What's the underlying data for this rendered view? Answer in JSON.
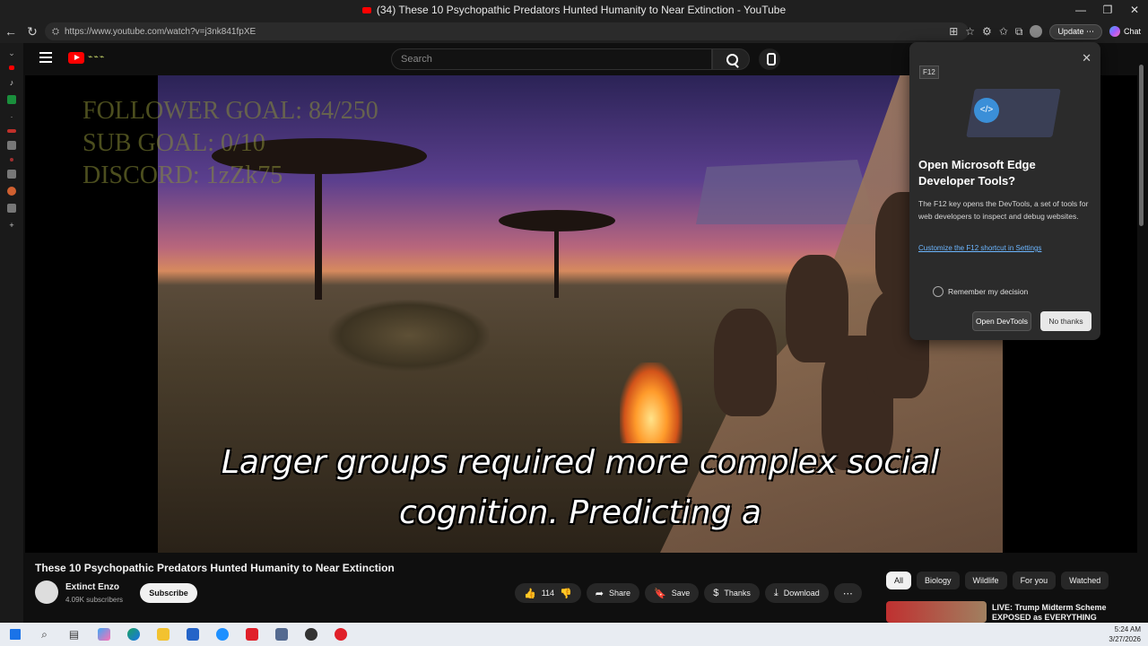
{
  "window": {
    "title": "(34) These 10 Psychopathic Predators Hunted Humanity to Near Extinction - YouTube",
    "controls": [
      "—",
      "❐",
      "✕"
    ]
  },
  "browser": {
    "url": "https://www.youtube.com/watch?v=j3nk841fpXE",
    "update_label": "Update",
    "chat_label": "Chat"
  },
  "header": {
    "search_placeholder": "Search"
  },
  "stream_overlay": {
    "line1": "FOLLOWER GOAL: 84/250",
    "line2": "SUB GOAL: 0/10",
    "line3": "DISCORD: 1zZk75"
  },
  "caption": {
    "line1": "Larger groups required more complex social",
    "line2": "cognition. Predicting a"
  },
  "devtools_popup": {
    "key_badge": "F12",
    "title": "Open Microsoft Edge Developer Tools?",
    "body": "The F12 key opens the DevTools, a set of tools for web developers to inspect and debug websites.",
    "link": "Customize the F12 shortcut in Settings",
    "remember": "Remember my decision",
    "open_btn": "Open DevTools",
    "no_btn": "No thanks"
  },
  "video": {
    "title": "These 10 Psychopathic Predators Hunted Humanity to Near Extinction",
    "channel": "Extinct Enzo",
    "subscribers": "4.09K subscribers",
    "subscribe_label": "Subscribe",
    "likes": "114",
    "share": "Share",
    "save": "Save",
    "thanks": "Thanks",
    "download": "Download"
  },
  "chips": [
    "All",
    "Biology",
    "Wildlife",
    "For you",
    "Watched"
  ],
  "recommendation": {
    "title": "LIVE: Trump Midterm Scheme EXPOSED as EVERYTHING"
  },
  "clock": {
    "time": "5:24 AM",
    "date": "3/27/2026"
  },
  "colors": {
    "youtube_red": "#ff0000",
    "background": "#0f0f0f",
    "link_blue": "#6cb6ff"
  }
}
